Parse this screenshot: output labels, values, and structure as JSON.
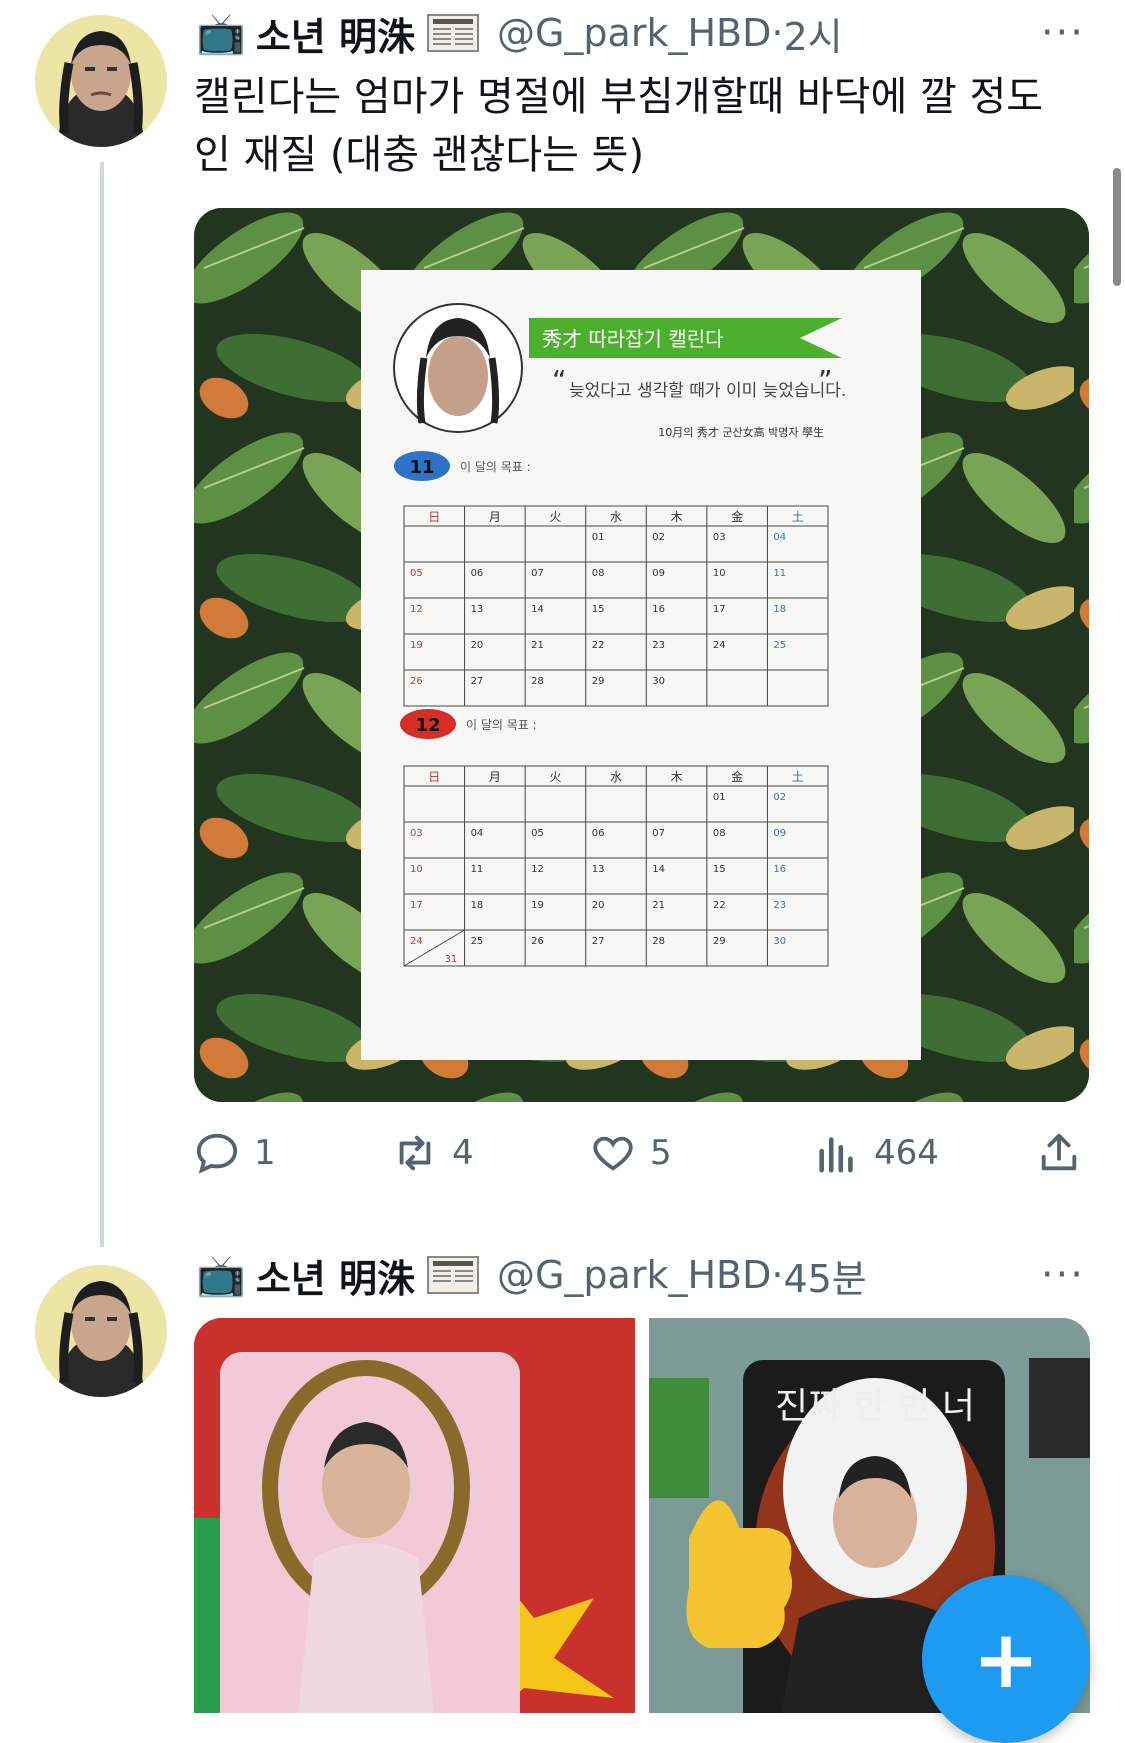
{
  "tweet1": {
    "tv_emoji": "📺",
    "display_name": "소년 明洙",
    "handle": "@G_park_HBD",
    "dot": "·",
    "time": "2시",
    "text": "캘린다는 엄마가 명절에 부침개할때 바닥에 깔 정도인 재질 (대충 괜찮다는 뜻)",
    "more": "···",
    "calendar": {
      "banner": "秀才 따라잡기 캘린다",
      "quote": "늦었다고 생각할 때가 이미 늦었습니다.",
      "open_quote": "“",
      "close_quote": "”",
      "credit": "10月의 秀才 군산女高 박명자 學生",
      "goal_label": "이 달의 목표 :",
      "weekdays": [
        "日",
        "月",
        "火",
        "水",
        "木",
        "金",
        "土"
      ],
      "months": [
        {
          "badge": "11",
          "badge_color": "#2f73c9",
          "weeks": [
            [
              "",
              "",
              "",
              "01",
              "02",
              "03",
              "04"
            ],
            [
              "05",
              "06",
              "07",
              "08",
              "09",
              "10",
              "11"
            ],
            [
              "12",
              "13",
              "14",
              "15",
              "16",
              "17",
              "18"
            ],
            [
              "19",
              "20",
              "21",
              "22",
              "23",
              "24",
              "25"
            ],
            [
              "26",
              "27",
              "28",
              "29",
              "30",
              "",
              ""
            ]
          ]
        },
        {
          "badge": "12",
          "badge_color": "#d72d27",
          "weeks": [
            [
              "",
              "",
              "",
              "",
              "",
              "01",
              "02"
            ],
            [
              "03",
              "04",
              "05",
              "06",
              "07",
              "08",
              "09"
            ],
            [
              "10",
              "11",
              "12",
              "13",
              "14",
              "15",
              "16"
            ],
            [
              "17",
              "18",
              "19",
              "20",
              "21",
              "22",
              "23"
            ],
            [
              "24",
              "25",
              "26",
              "27",
              "28",
              "29",
              "30"
            ]
          ],
          "extra_day": "31"
        }
      ]
    },
    "stats": {
      "replies": "1",
      "retweets": "4",
      "likes": "5",
      "views": "464"
    }
  },
  "tweet2": {
    "tv_emoji": "📺",
    "display_name": "소년 明洙",
    "handle": "@G_park_HBD",
    "dot": "·",
    "time": "45분",
    "more": "···",
    "card_text": "진짜 한 번 너"
  },
  "fab_label": "+",
  "colors": {
    "accent": "#1d9bf0",
    "muted": "#536471",
    "sunday": "#c0392b",
    "saturday": "#2f73c9",
    "banner": "#4caf2d"
  }
}
